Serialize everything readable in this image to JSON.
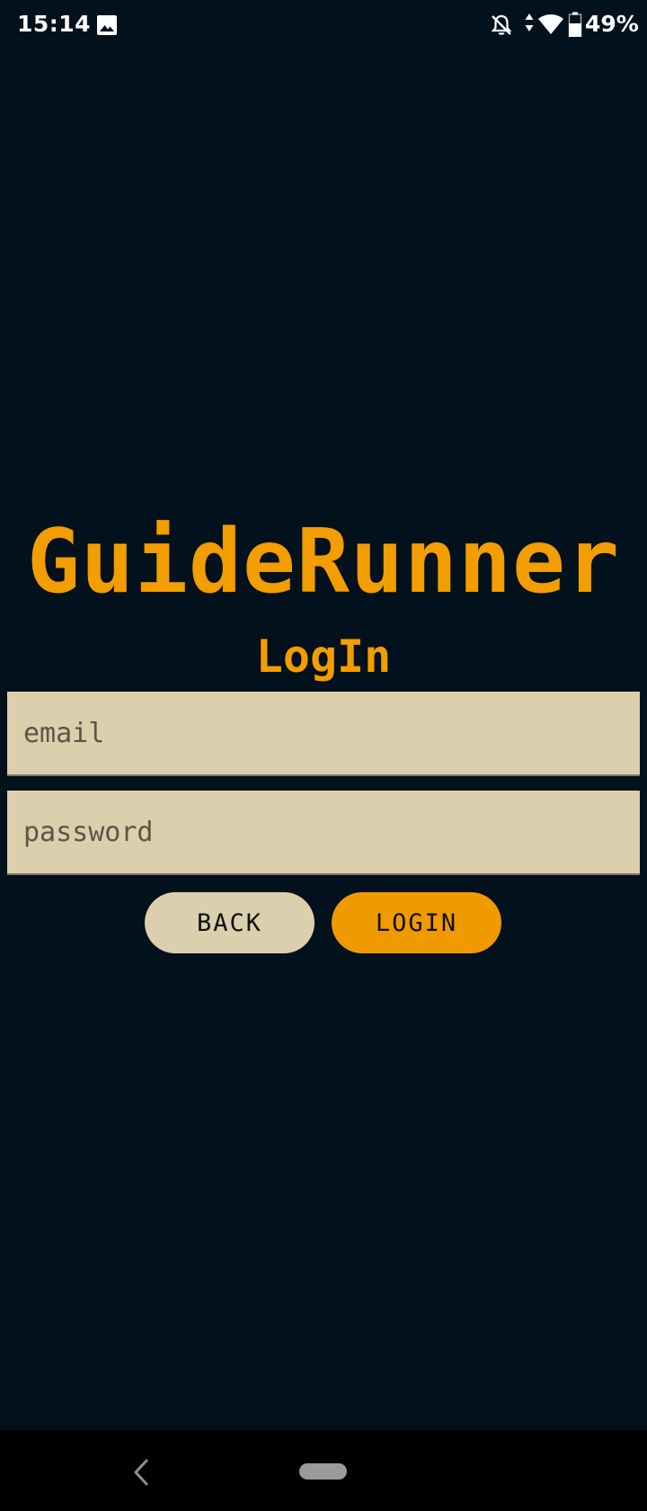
{
  "status_bar": {
    "time": "15:14",
    "battery_percent": "49%",
    "icons": [
      "gallery-icon",
      "bell-off-icon",
      "data-arrows-icon",
      "wifi-icon",
      "battery-icon"
    ]
  },
  "app": {
    "title": "GuideRunner",
    "subtitle": "LogIn"
  },
  "form": {
    "email_placeholder": "email",
    "email_value": "",
    "password_placeholder": "password",
    "password_value": ""
  },
  "buttons": {
    "back_label": "BACK",
    "login_label": "LOGIN"
  },
  "nav_bar": {
    "icons": [
      "nav-back-icon",
      "home-pill"
    ]
  },
  "colors": {
    "background": "#02111b",
    "accent": "#f29d00",
    "field_background": "#dbcfad",
    "back_button": "#dbcfad",
    "login_button": "#f09a00"
  }
}
